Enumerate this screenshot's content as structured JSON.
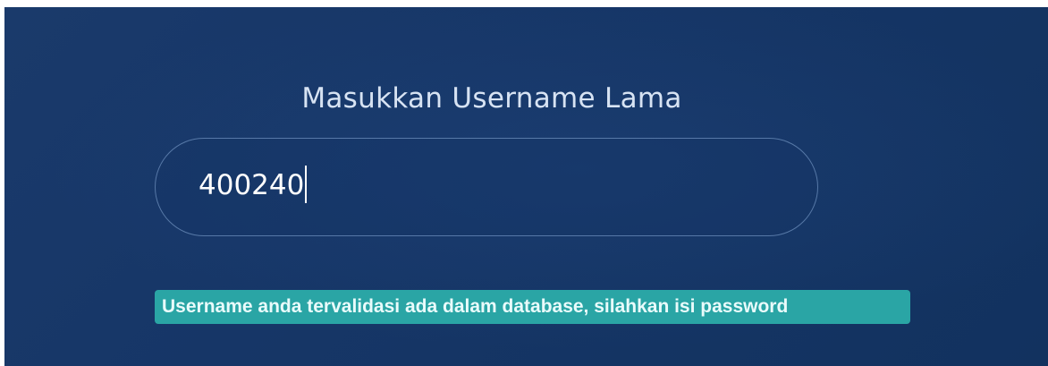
{
  "form": {
    "title": "Masukkan Username Lama",
    "username_value": "400240",
    "validation_message": "Username anda tervalidasi ada dalam database, silahkan isi password"
  },
  "colors": {
    "background": "#163667",
    "notice_background": "#2aa5a5",
    "notice_text": "#e9fbfb",
    "title_text": "#d7e3f3",
    "input_border": "#8cafdc"
  }
}
